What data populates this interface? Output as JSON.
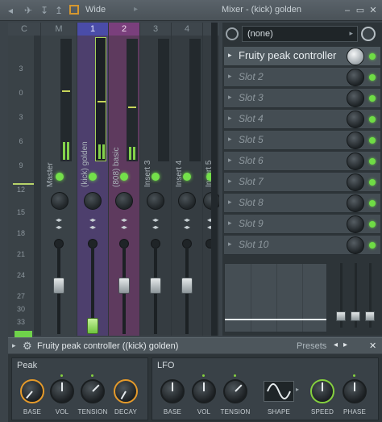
{
  "titlebar": {
    "preset_label": "Wide",
    "window_title": "Mixer - (kick) golden",
    "icons": [
      "bird-icon",
      "arrow-down-icon",
      "arrow-up-icon",
      "grid-icon",
      "orange-box-icon"
    ]
  },
  "mixer": {
    "header": [
      "C",
      "M",
      "1",
      "2",
      "3",
      "4"
    ],
    "scale": [
      "3",
      "0",
      "3",
      "6",
      "9",
      "12",
      "15",
      "18",
      "21",
      "24",
      "27",
      "30",
      "33"
    ],
    "strips": [
      {
        "name": "Master",
        "header": "M",
        "meter_l": 0.15,
        "meter_r": 0.15
      },
      {
        "name": "(kick) golden",
        "header": "1",
        "meter_l": 0.12,
        "meter_r": 0.12
      },
      {
        "name": "(808) basic",
        "header": "2",
        "meter_l": 0.12,
        "meter_r": 0.12
      },
      {
        "name": "Insert 3",
        "header": "3",
        "meter_l": 0,
        "meter_r": 0
      },
      {
        "name": "Insert 4",
        "header": "4",
        "meter_l": 0,
        "meter_r": 0
      },
      {
        "name": "Insert 5",
        "header": "",
        "meter_l": 0,
        "meter_r": 0
      }
    ]
  },
  "slots": {
    "preset": "(none)",
    "items": [
      {
        "label": "Fruity peak controller",
        "active": true
      },
      {
        "label": "Slot 2",
        "active": false
      },
      {
        "label": "Slot 3",
        "active": false
      },
      {
        "label": "Slot 4",
        "active": false
      },
      {
        "label": "Slot 5",
        "active": false
      },
      {
        "label": "Slot 6",
        "active": false
      },
      {
        "label": "Slot 7",
        "active": false
      },
      {
        "label": "Slot 8",
        "active": false
      },
      {
        "label": "Slot 9",
        "active": false
      },
      {
        "label": "Slot 10",
        "active": false
      }
    ]
  },
  "plugin": {
    "title": "Fruity peak controller ((kick) golden)",
    "presets_label": "Presets",
    "peak": {
      "title": "Peak",
      "knobs": [
        {
          "label": "BASE",
          "style": "orange",
          "angle": -140
        },
        {
          "label": "VOL",
          "style": "plain",
          "angle": 0
        },
        {
          "label": "TENSION",
          "style": "plain",
          "angle": 45
        },
        {
          "label": "DECAY",
          "style": "orange",
          "angle": -150
        }
      ]
    },
    "lfo": {
      "title": "LFO",
      "knobs": [
        {
          "label": "BASE",
          "style": "plain",
          "angle": 0
        },
        {
          "label": "VOL",
          "style": "plain",
          "angle": 0
        },
        {
          "label": "TENSION",
          "style": "plain",
          "angle": 45
        },
        {
          "label": "SHAPE",
          "style": "shape",
          "angle": 0
        },
        {
          "label": "SPEED",
          "style": "green",
          "angle": 0
        },
        {
          "label": "PHASE",
          "style": "plain",
          "angle": 0
        }
      ]
    }
  }
}
